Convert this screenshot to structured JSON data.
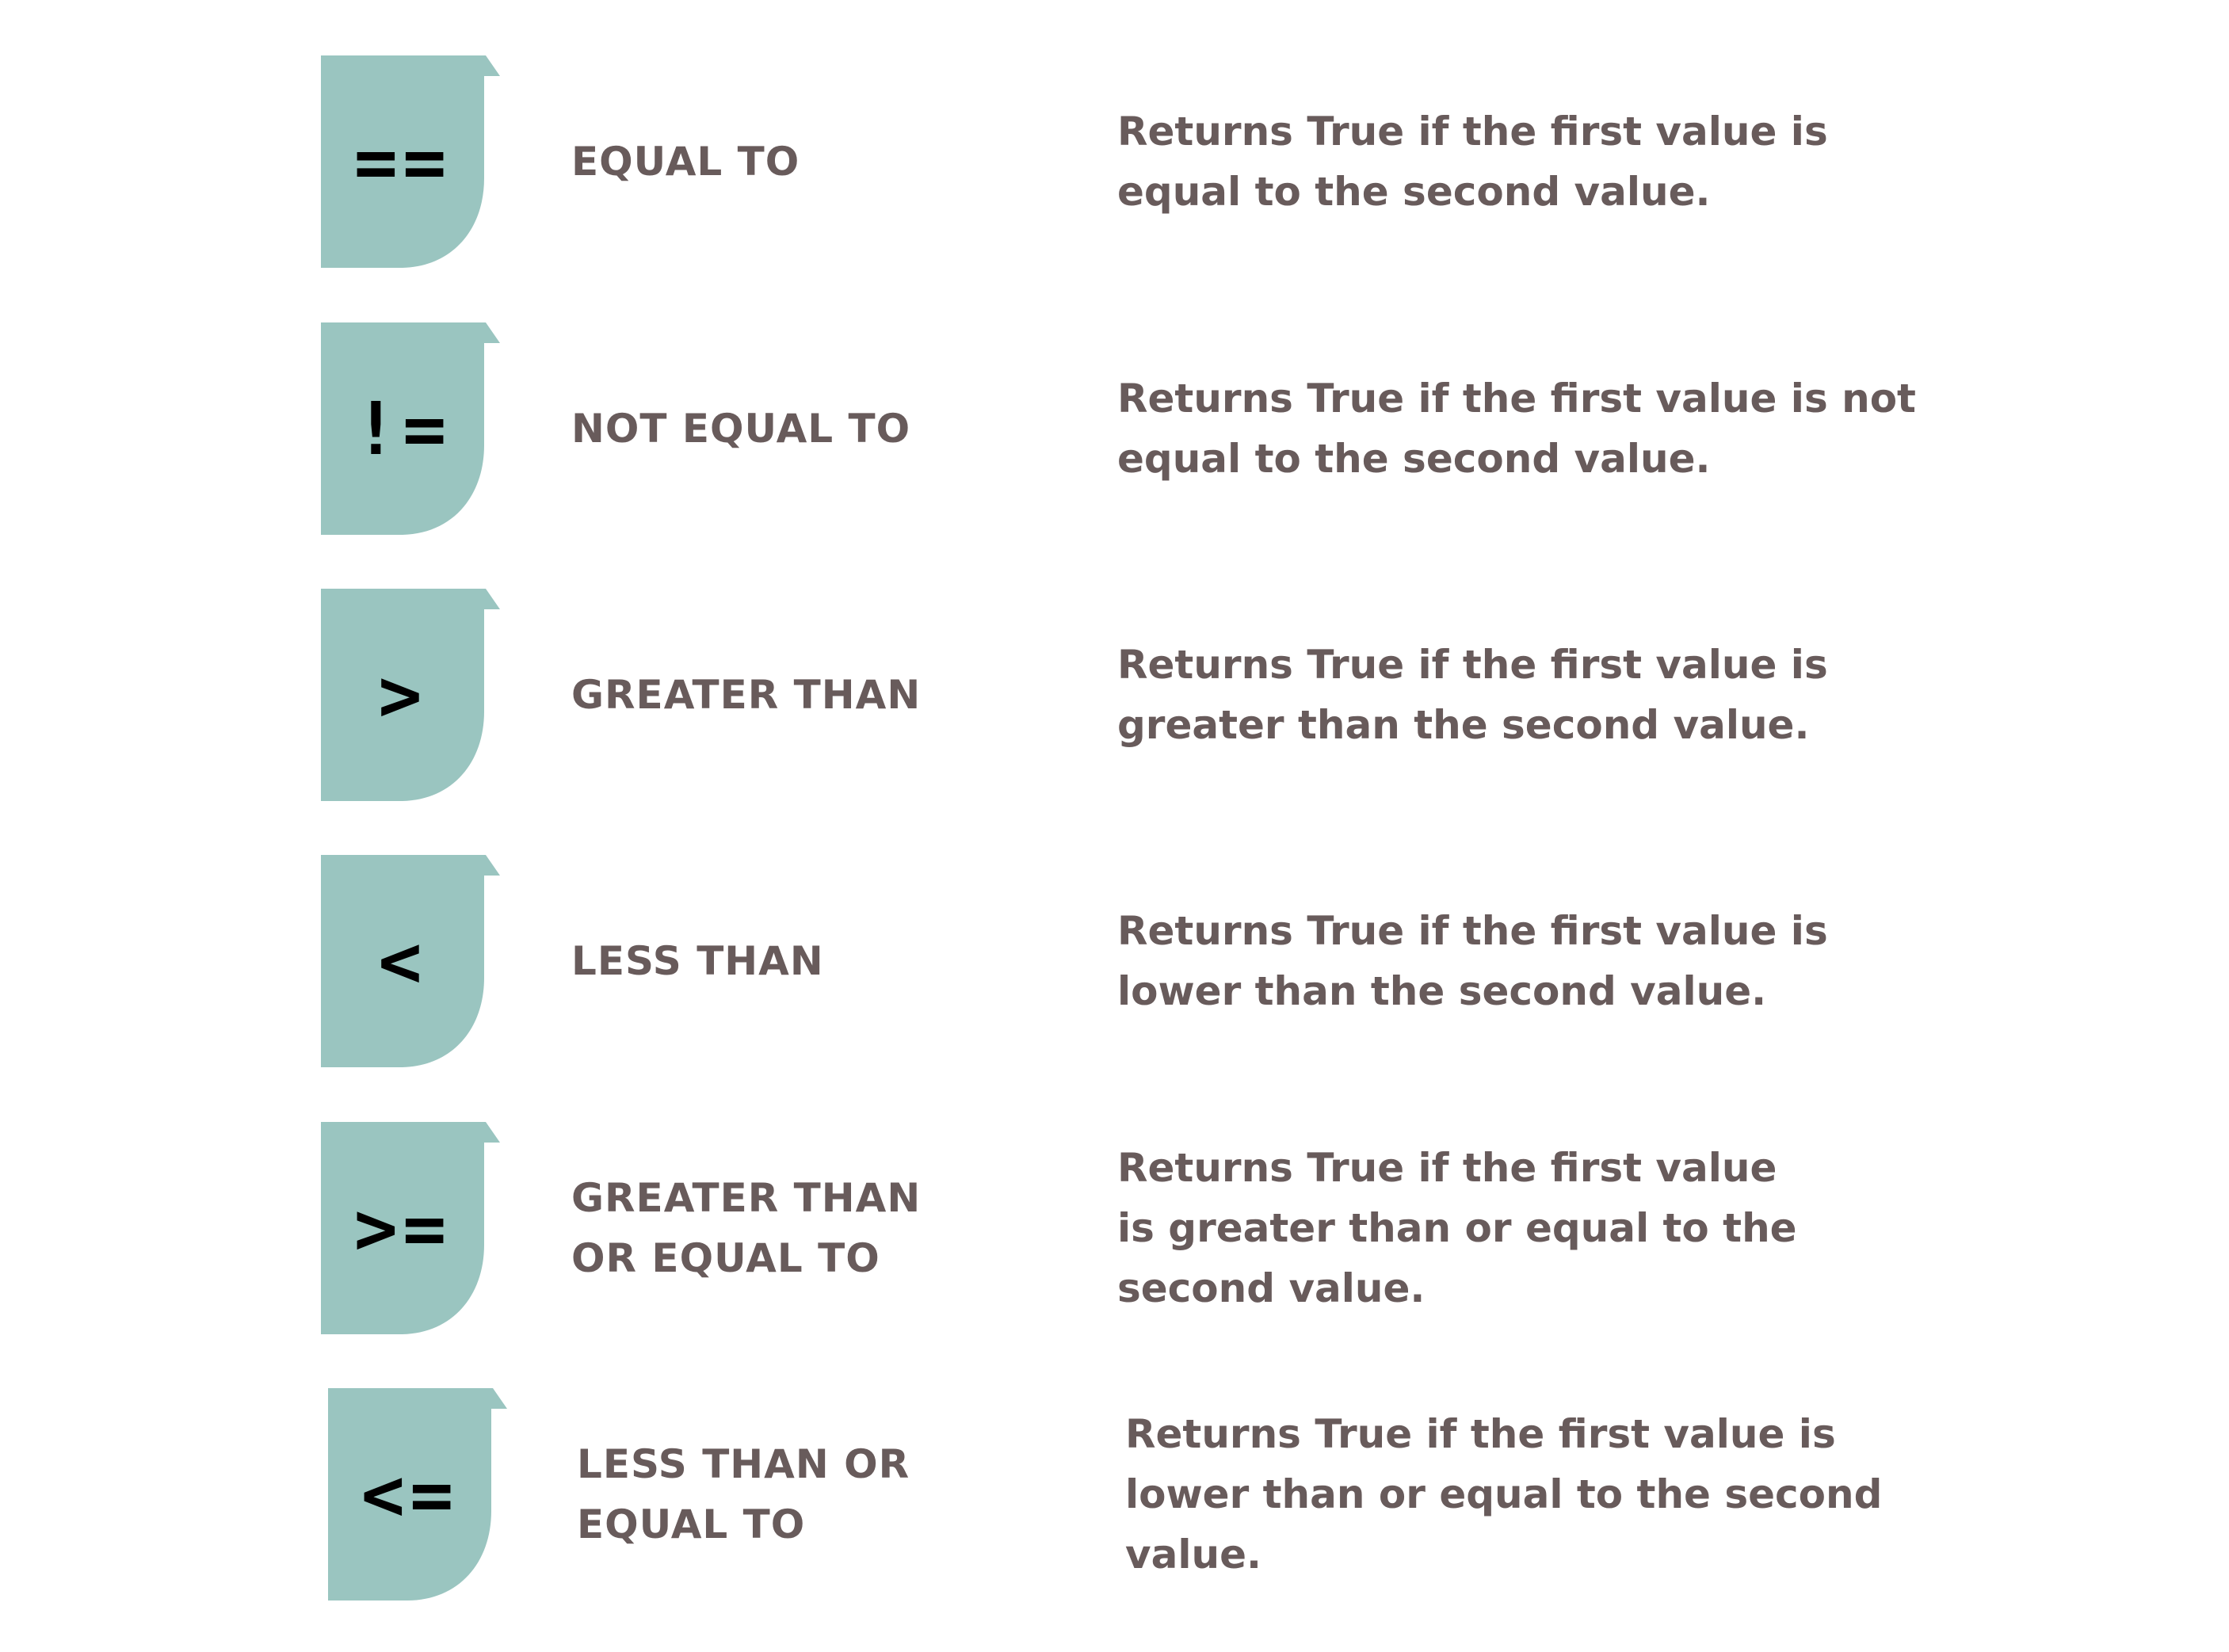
{
  "colors": {
    "badge": "#9AC5C0",
    "text": "#685B5B",
    "symbol": "#000000"
  },
  "operators": [
    {
      "symbol": "==",
      "label": "EQUAL TO",
      "description": "Returns True if the first value is equal to the second value."
    },
    {
      "symbol": "!=",
      "label": "NOT EQUAL TO",
      "description": "Returns True if the first value is not equal to the second value."
    },
    {
      "symbol": ">",
      "label": "GREATER THAN",
      "description": "Returns True if the first value is greater than the second value."
    },
    {
      "symbol": "<",
      "label": "LESS THAN",
      "description": "Returns True if the first value is lower than the second value."
    },
    {
      "symbol": ">=",
      "label": "GREATER THAN OR EQUAL TO",
      "description": "Returns True if the first value is greater than or equal to the second value."
    },
    {
      "symbol": "<=",
      "label": "LESS THAN OR EQUAL TO",
      "description": "Returns True if the first value is lower than or equal to the second value."
    }
  ]
}
